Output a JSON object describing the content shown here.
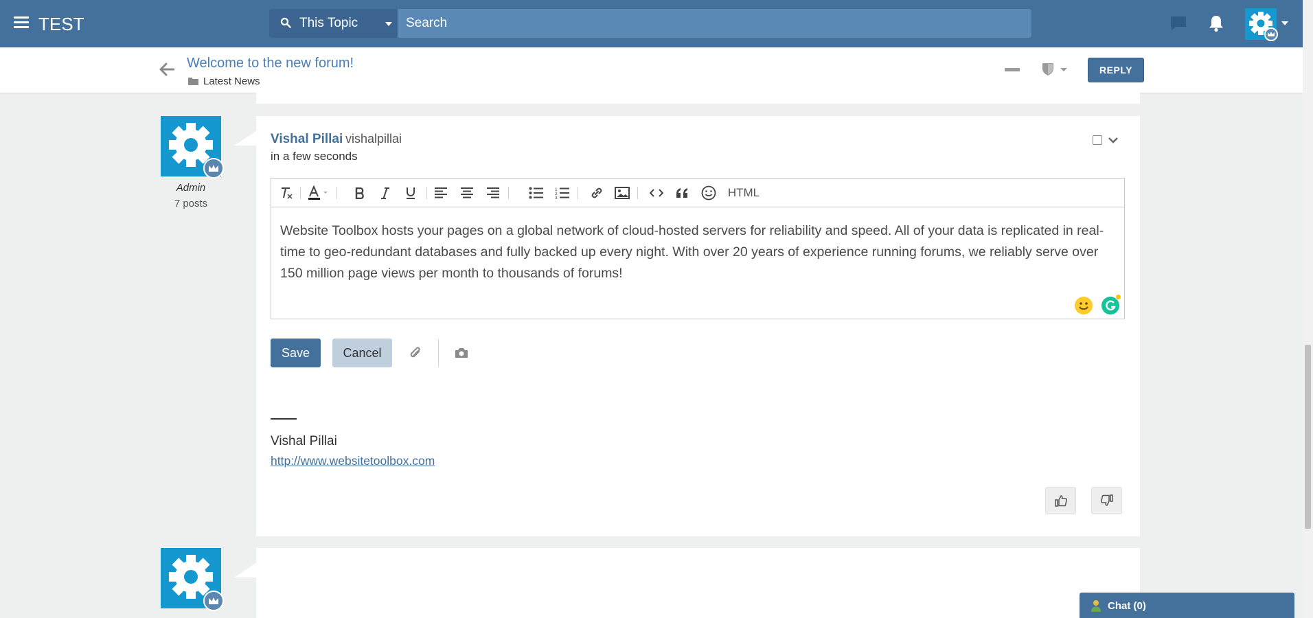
{
  "header": {
    "brand": "TEST",
    "search_scope": "This Topic",
    "search_placeholder": "Search"
  },
  "topic": {
    "title": "Welcome to the new forum!",
    "category": "Latest News",
    "reply_label": "REPLY"
  },
  "post": {
    "author_display": "Vishal Pillai",
    "author_username": "vishalpillai",
    "timestamp": "in a few seconds",
    "role": "Admin",
    "post_count": "7 posts"
  },
  "editor": {
    "html_label": "HTML",
    "body": "Website Toolbox hosts your pages on a global network of cloud-hosted servers for reliability and speed. All of your data is replicated in real-time to geo-redundant databases and fully backed up every night. With over 20 years of experience running forums, we reliably serve over 150 million page views per month to thousands of forums!",
    "save_label": "Save",
    "cancel_label": "Cancel"
  },
  "signature": {
    "name": "Vishal Pillai",
    "link": "http://www.websitetoolbox.com"
  },
  "chat": {
    "label": "Chat (0)"
  },
  "colors": {
    "topbar": "#44709c",
    "accent": "#1597cf",
    "link": "#4a7db3",
    "page_bg": "#eef0ef"
  },
  "icons": [
    "menu-icon",
    "search-icon",
    "chat-bubble-icon",
    "bell-icon",
    "gear-icon",
    "crown-icon",
    "back-arrow-icon",
    "folder-icon",
    "minus-icon",
    "shield-icon",
    "clear-format-icon",
    "font-color-icon",
    "bold-icon",
    "italic-icon",
    "underline-icon",
    "align-left-icon",
    "align-center-icon",
    "align-right-icon",
    "bulleted-list-icon",
    "numbered-list-icon",
    "link-icon",
    "image-icon",
    "code-icon",
    "quote-icon",
    "smiley-icon",
    "paperclip-icon",
    "camera-icon",
    "thumbs-up-icon",
    "thumbs-down-icon",
    "user-icon"
  ]
}
